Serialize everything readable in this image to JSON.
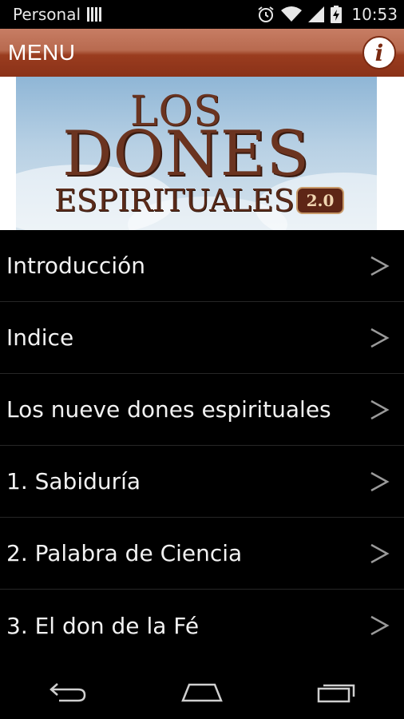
{
  "status_bar": {
    "carrier": "Personal",
    "time": "10:53",
    "icons": [
      "sim-icon",
      "alarm-icon",
      "wifi-icon",
      "signal-icon",
      "battery-charging-icon"
    ]
  },
  "header": {
    "title": "MENU",
    "info_icon": "info-icon",
    "info_glyph": "i",
    "background_color": "#9a3c1f"
  },
  "banner": {
    "line1": "LOS",
    "line2": "DONES",
    "line3": "ESPIRITUALES",
    "badge": "2.0"
  },
  "menu_items": [
    {
      "label": "Introducción",
      "icon": "chevron-right-icon"
    },
    {
      "label": "Indice",
      "icon": "chevron-right-icon"
    },
    {
      "label": "Los nueve dones espirituales",
      "icon": "chevron-right-icon"
    },
    {
      "label": "1. Sabiduría",
      "icon": "chevron-right-icon"
    },
    {
      "label": "2. Palabra de Ciencia",
      "icon": "chevron-right-icon"
    },
    {
      "label": "3. El don de la Fé",
      "icon": "chevron-right-icon"
    }
  ],
  "nav_bar": {
    "buttons": [
      "back-icon",
      "home-icon",
      "recent-apps-icon"
    ]
  }
}
